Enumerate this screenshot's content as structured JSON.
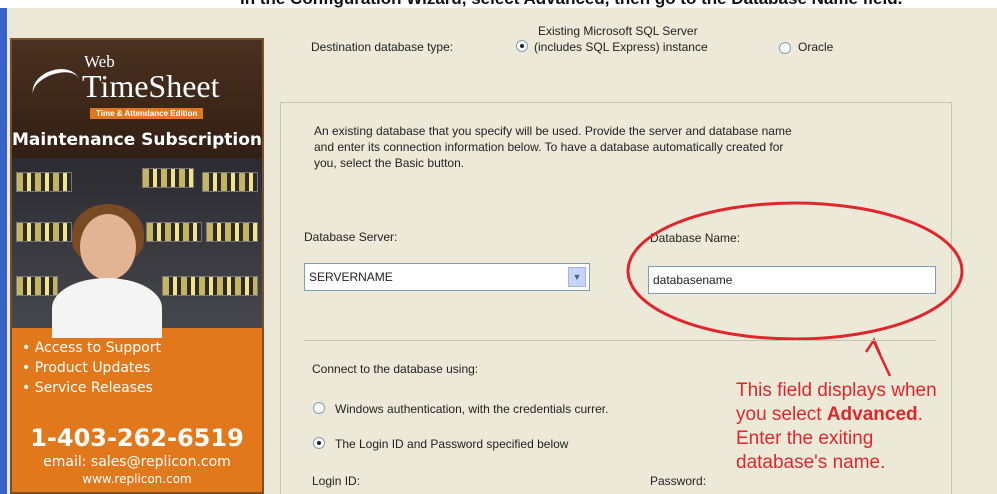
{
  "header_caption": "In the Configuration Wizard, select Advanced, then go to the Database Name field.",
  "ad": {
    "logo_small": "Web",
    "logo_big": "TimeSheet",
    "edition": "Time & Attendance Edition",
    "subtitle": "Maintenance Subscription",
    "bullets": [
      "• Access to Support",
      "• Product Updates",
      "• Service Releases"
    ],
    "phone": "1-403-262-6519",
    "email": "email: sales@replicon.com",
    "website": "www.replicon.com"
  },
  "destination": {
    "label": "Destination database type:",
    "option_sql_line1": "Existing Microsoft SQL Server",
    "option_sql_line2": "(includes SQL Express) instance",
    "option_oracle": "Oracle",
    "selected": "sql"
  },
  "description": [
    "An existing database that you specify will be used.  Provide the server and database name",
    "and enter its connection information below. To have a database automatically created for",
    "you, select the Basic button."
  ],
  "server": {
    "label": "Database Server:",
    "value": "SERVERNAME"
  },
  "dbname": {
    "label": "Database Name:",
    "value": "databasename"
  },
  "connect": {
    "label": "Connect to the database using:",
    "option_windows": "Windows authentication, with the credentials currer.",
    "option_login": "The Login ID and Password specified below",
    "selected": "login"
  },
  "login_label": "Login ID:",
  "password_label": "Password:",
  "annotation": {
    "line1": "This field displays when",
    "line2_prefix": "you select ",
    "line2_bold": "Advanced",
    "line2_suffix": ".",
    "line3": "Enter the exiting",
    "line4": "database's name."
  },
  "colors": {
    "annotation": "#e0262b",
    "window_bg": "#ece9d8",
    "ad_orange": "#e1781c"
  }
}
